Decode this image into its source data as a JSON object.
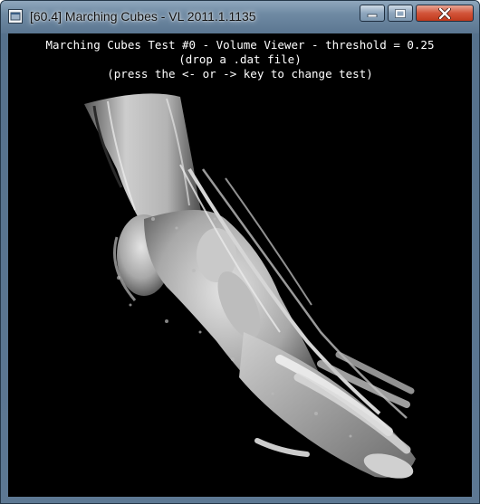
{
  "window": {
    "title": "[60.4] Marching Cubes - VL 2011.1.1135",
    "app_icon": "app-window-icon",
    "controls": {
      "minimize_icon": "minimize-icon",
      "maximize_icon": "maximize-icon",
      "close_icon": "close-icon"
    }
  },
  "viewport": {
    "background": "#000000",
    "overlay_lines": [
      "Marching Cubes Test #0 - Volume Viewer - threshold = 0.25",
      "(drop a .dat file)",
      "(press the <- or -> key to change test)"
    ]
  }
}
